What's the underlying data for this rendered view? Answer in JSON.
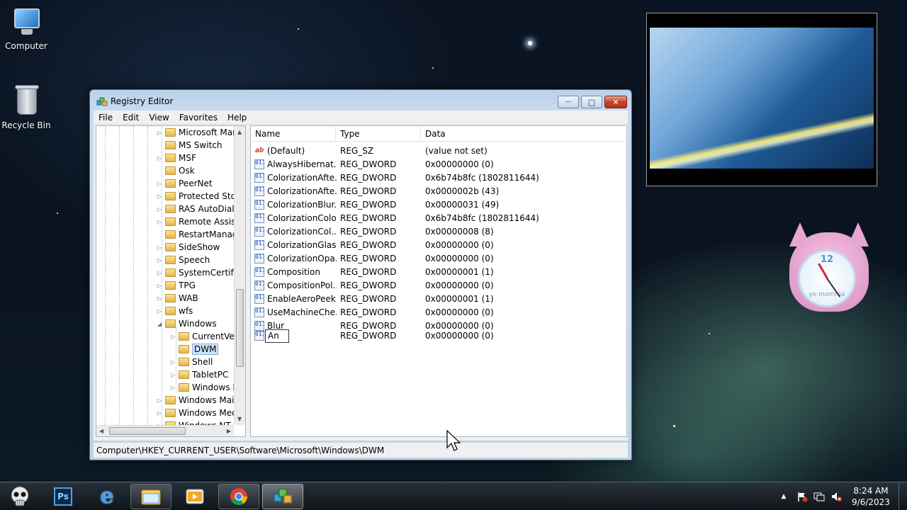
{
  "desktop": {
    "icons": [
      {
        "label": "Computer"
      },
      {
        "label": "Recycle Bin"
      }
    ]
  },
  "gadgets": {
    "clock": {
      "numeral": "12",
      "brand": "yo momma"
    }
  },
  "window": {
    "title": "Registry Editor",
    "controls": {
      "minimize": "—",
      "maximize": "□",
      "close": "✕"
    },
    "menu": [
      "File",
      "Edit",
      "View",
      "Favorites",
      "Help"
    ],
    "tree": {
      "items": [
        {
          "label": "Microsoft Mar",
          "level": 0,
          "expander": "▷",
          "selected": false
        },
        {
          "label": "MS Switch",
          "level": 0,
          "expander": "",
          "selected": false
        },
        {
          "label": "MSF",
          "level": 0,
          "expander": "▷",
          "selected": false
        },
        {
          "label": "Osk",
          "level": 0,
          "expander": "",
          "selected": false
        },
        {
          "label": "PeerNet",
          "level": 0,
          "expander": "▷",
          "selected": false
        },
        {
          "label": "Protected Stor",
          "level": 0,
          "expander": "▷",
          "selected": false
        },
        {
          "label": "RAS AutoDial",
          "level": 0,
          "expander": "▷",
          "selected": false
        },
        {
          "label": "Remote Assist",
          "level": 0,
          "expander": "▷",
          "selected": false
        },
        {
          "label": "RestartManag",
          "level": 0,
          "expander": "",
          "selected": false
        },
        {
          "label": "SideShow",
          "level": 0,
          "expander": "▷",
          "selected": false
        },
        {
          "label": "Speech",
          "level": 0,
          "expander": "▷",
          "selected": false
        },
        {
          "label": "SystemCertific",
          "level": 0,
          "expander": "▷",
          "selected": false
        },
        {
          "label": "TPG",
          "level": 0,
          "expander": "▷",
          "selected": false
        },
        {
          "label": "WAB",
          "level": 0,
          "expander": "▷",
          "selected": false
        },
        {
          "label": "wfs",
          "level": 0,
          "expander": "▷",
          "selected": false
        },
        {
          "label": "Windows",
          "level": 0,
          "expander": "◢",
          "selected": false
        },
        {
          "label": "CurrentVer",
          "level": 1,
          "expander": "▷",
          "selected": false
        },
        {
          "label": "DWM",
          "level": 1,
          "expander": "",
          "selected": true
        },
        {
          "label": "Shell",
          "level": 1,
          "expander": "▷",
          "selected": false
        },
        {
          "label": "TabletPC",
          "level": 1,
          "expander": "▷",
          "selected": false
        },
        {
          "label": "Windows E",
          "level": 1,
          "expander": "▷",
          "selected": false
        },
        {
          "label": "Windows Mail",
          "level": 0,
          "expander": "▷",
          "selected": false
        },
        {
          "label": "Windows Med",
          "level": 0,
          "expander": "▷",
          "selected": false
        },
        {
          "label": "Windows NT",
          "level": 0,
          "expander": "▷",
          "selected": false
        }
      ]
    },
    "columns": {
      "name": "Name",
      "type": "Type",
      "data": "Data"
    },
    "values": [
      {
        "icon": "ab",
        "name": "(Default)",
        "type": "REG_SZ",
        "data": "(value not set)"
      },
      {
        "icon": "011",
        "name": "AlwaysHibernat...",
        "type": "REG_DWORD",
        "data": "0x00000000 (0)"
      },
      {
        "icon": "011",
        "name": "ColorizationAfte...",
        "type": "REG_DWORD",
        "data": "0x6b74b8fc (1802811644)"
      },
      {
        "icon": "011",
        "name": "ColorizationAfte...",
        "type": "REG_DWORD",
        "data": "0x0000002b (43)"
      },
      {
        "icon": "011",
        "name": "ColorizationBlur...",
        "type": "REG_DWORD",
        "data": "0x00000031 (49)"
      },
      {
        "icon": "011",
        "name": "ColorizationColor",
        "type": "REG_DWORD",
        "data": "0x6b74b8fc (1802811644)"
      },
      {
        "icon": "011",
        "name": "ColorizationCol...",
        "type": "REG_DWORD",
        "data": "0x00000008 (8)"
      },
      {
        "icon": "011",
        "name": "ColorizationGlas...",
        "type": "REG_DWORD",
        "data": "0x00000000 (0)"
      },
      {
        "icon": "011",
        "name": "ColorizationOpa...",
        "type": "REG_DWORD",
        "data": "0x00000000 (0)"
      },
      {
        "icon": "011",
        "name": "Composition",
        "type": "REG_DWORD",
        "data": "0x00000001 (1)"
      },
      {
        "icon": "011",
        "name": "CompositionPol...",
        "type": "REG_DWORD",
        "data": "0x00000000 (0)"
      },
      {
        "icon": "011",
        "name": "EnableAeroPeek",
        "type": "REG_DWORD",
        "data": "0x00000001 (1)"
      },
      {
        "icon": "011",
        "name": "UseMachineChe...",
        "type": "REG_DWORD",
        "data": "0x00000000 (0)"
      },
      {
        "icon": "011",
        "name": "Blur",
        "type": "REG_DWORD",
        "data": "0x00000000 (0)"
      }
    ],
    "editing_row": {
      "icon": "011",
      "value": "An",
      "type": "REG_DWORD",
      "data": "0x00000000 (0)"
    },
    "status": "Computer\\HKEY_CURRENT_USER\\Software\\Microsoft\\Windows\\DWM"
  },
  "taskbar": {
    "pinned": [
      {
        "name": "start-orb-icon"
      },
      {
        "name": "photoshop-icon",
        "text": "Ps"
      },
      {
        "name": "internet-explorer-icon",
        "text": "e"
      },
      {
        "name": "file-explorer-icon"
      },
      {
        "name": "media-player-icon"
      },
      {
        "name": "chrome-icon"
      },
      {
        "name": "regedit-icon"
      }
    ],
    "tray": {
      "show_hidden": "▲",
      "time": "8:24 AM",
      "date": "9/6/2023"
    }
  },
  "colors": {
    "selection": "#cde3f7",
    "titlebar": "#b9d1ea",
    "close_button": "#c7412c"
  }
}
